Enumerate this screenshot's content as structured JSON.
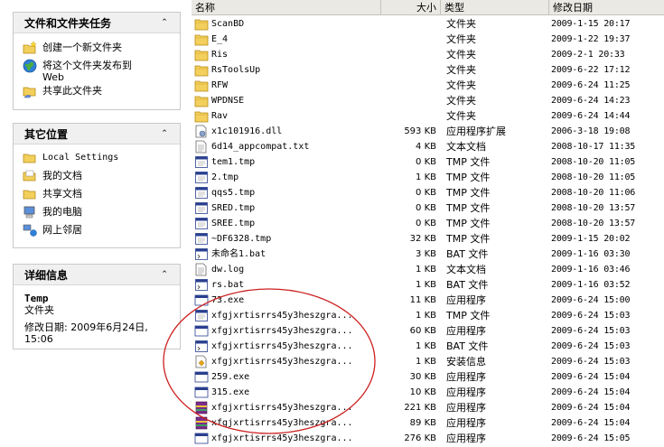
{
  "task_panel": {
    "title": "文件和文件夹任务",
    "items": [
      {
        "label": "创建一个新文件夹"
      },
      {
        "label": "将这个文件夹发布到",
        "label2": "Web"
      },
      {
        "label": "共享此文件夹"
      }
    ]
  },
  "places_panel": {
    "title": "其它位置",
    "items": [
      {
        "label": "Local Settings"
      },
      {
        "label": "我的文档"
      },
      {
        "label": "共享文档"
      },
      {
        "label": "我的电脑"
      },
      {
        "label": "网上邻居"
      }
    ]
  },
  "details_panel": {
    "title": "详细信息",
    "name": "Temp",
    "type": "文件夹",
    "modified_line1": "修改日期: 2009年6月24日,",
    "modified_line2": "15:06"
  },
  "columns": {
    "name": "名称",
    "size": "大小",
    "type": "类型",
    "date": "修改日期"
  },
  "files": [
    {
      "name": "ScanBD",
      "size": "",
      "type": "文件夹",
      "date": "2009-1-15 20:17",
      "icon": "folder-icon"
    },
    {
      "name": "E_4",
      "size": "",
      "type": "文件夹",
      "date": "2009-1-22 19:37",
      "icon": "folder-icon"
    },
    {
      "name": "Ris",
      "size": "",
      "type": "文件夹",
      "date": "2009-2-1 20:33",
      "icon": "folder-icon"
    },
    {
      "name": "RsToolsUp",
      "size": "",
      "type": "文件夹",
      "date": "2009-6-22 17:12",
      "icon": "folder-icon"
    },
    {
      "name": "RFW",
      "size": "",
      "type": "文件夹",
      "date": "2009-6-24 11:25",
      "icon": "folder-icon"
    },
    {
      "name": "WPDNSE",
      "size": "",
      "type": "文件夹",
      "date": "2009-6-24 14:23",
      "icon": "folder-icon"
    },
    {
      "name": "Rav",
      "size": "",
      "type": "文件夹",
      "date": "2009-6-24 14:44",
      "icon": "folder-icon"
    },
    {
      "name": "x1c101916.dll",
      "size": "593 KB",
      "type": "应用程序扩展",
      "date": "2006-3-18 19:08",
      "icon": "dll-icon"
    },
    {
      "name": "6d14_appcompat.txt",
      "size": "4 KB",
      "type": "文本文档",
      "date": "2008-10-17 11:35",
      "icon": "text-file-icon"
    },
    {
      "name": "tem1.tmp",
      "size": "0 KB",
      "type": "TMP 文件",
      "date": "2008-10-20 11:05",
      "icon": "tmp-file-icon"
    },
    {
      "name": "2.tmp",
      "size": "1 KB",
      "type": "TMP 文件",
      "date": "2008-10-20 11:05",
      "icon": "tmp-file-icon"
    },
    {
      "name": "qqs5.tmp",
      "size": "0 KB",
      "type": "TMP 文件",
      "date": "2008-10-20 11:06",
      "icon": "tmp-file-icon"
    },
    {
      "name": "SRED.tmp",
      "size": "0 KB",
      "type": "TMP 文件",
      "date": "2008-10-20 13:57",
      "icon": "tmp-file-icon"
    },
    {
      "name": "SREE.tmp",
      "size": "0 KB",
      "type": "TMP 文件",
      "date": "2008-10-20 13:57",
      "icon": "tmp-file-icon"
    },
    {
      "name": "~DF6328.tmp",
      "size": "32 KB",
      "type": "TMP 文件",
      "date": "2009-1-15 20:02",
      "icon": "tmp-file-icon"
    },
    {
      "name": "未命名1.bat",
      "size": "3 KB",
      "type": "BAT 文件",
      "date": "2009-1-16 03:30",
      "icon": "bat-file-icon"
    },
    {
      "name": "dw.log",
      "size": "1 KB",
      "type": "文本文档",
      "date": "2009-1-16 03:46",
      "icon": "text-file-icon"
    },
    {
      "name": "rs.bat",
      "size": "1 KB",
      "type": "BAT 文件",
      "date": "2009-1-16 03:52",
      "icon": "bat-file-icon"
    },
    {
      "name": "73.exe",
      "size": "11 KB",
      "type": "应用程序",
      "date": "2009-6-24 15:00",
      "icon": "exe-icon"
    },
    {
      "name": "xfgjxrtisrrs45y3heszgra...",
      "size": "1 KB",
      "type": "TMP 文件",
      "date": "2009-6-24 15:03",
      "icon": "tmp-file-icon"
    },
    {
      "name": "xfgjxrtisrrs45y3heszgra...",
      "size": "60 KB",
      "type": "应用程序",
      "date": "2009-6-24 15:03",
      "icon": "exe-icon"
    },
    {
      "name": "xfgjxrtisrrs45y3heszgra...",
      "size": "1 KB",
      "type": "BAT 文件",
      "date": "2009-6-24 15:03",
      "icon": "bat-file-icon"
    },
    {
      "name": "xfgjxrtisrrs45y3heszgra...",
      "size": "1 KB",
      "type": "安装信息",
      "date": "2009-6-24 15:03",
      "icon": "setup-info-icon"
    },
    {
      "name": "259.exe",
      "size": "30 KB",
      "type": "应用程序",
      "date": "2009-6-24 15:04",
      "icon": "exe-icon"
    },
    {
      "name": "315.exe",
      "size": "10 KB",
      "type": "应用程序",
      "date": "2009-6-24 15:04",
      "icon": "exe-icon"
    },
    {
      "name": "xfgjxrtisrrs45y3heszgra...",
      "size": "221 KB",
      "type": "应用程序",
      "date": "2009-6-24 15:04",
      "icon": "rar-exe-icon"
    },
    {
      "name": "xfgjxrtisrrs45y3heszgra...",
      "size": "89 KB",
      "type": "应用程序",
      "date": "2009-6-24 15:04",
      "icon": "rar-exe-icon"
    },
    {
      "name": "xfgjxrtisrrs45y3heszgra...",
      "size": "276 KB",
      "type": "应用程序",
      "date": "2009-6-24 15:05",
      "icon": "exe-icon"
    }
  ],
  "colors": {
    "annotation_circle": "#cc2020",
    "folder": "#f3cf5c",
    "panel_header": "#f0f0f0"
  }
}
